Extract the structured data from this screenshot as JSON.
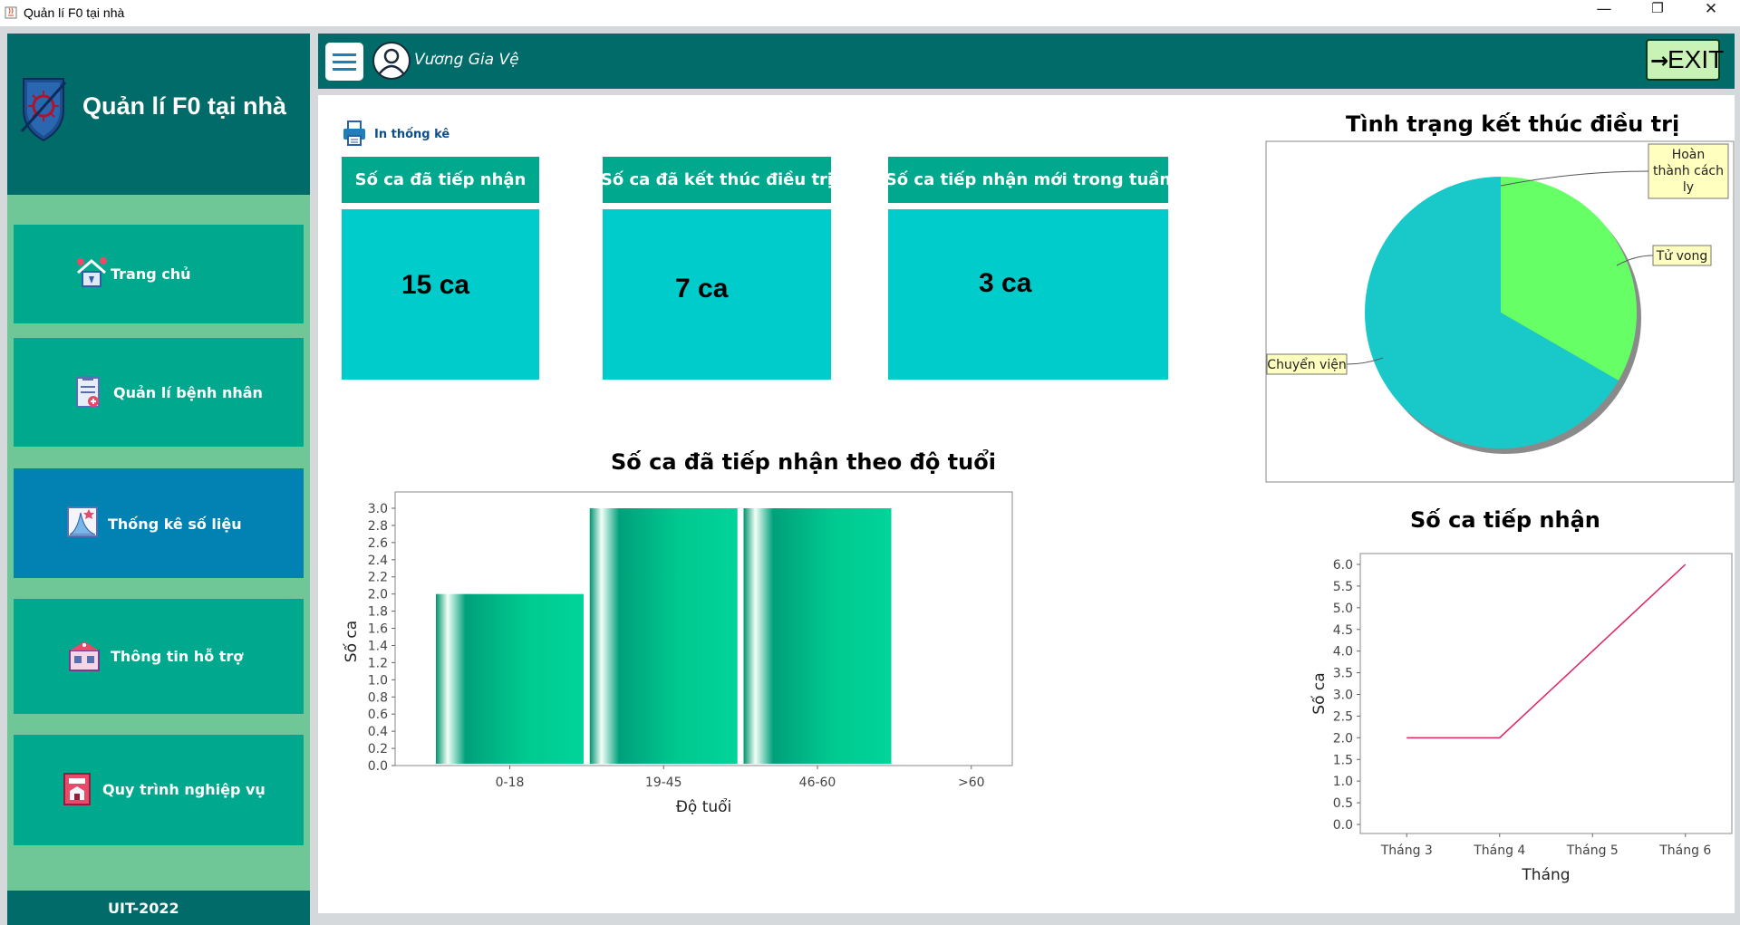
{
  "window": {
    "title": "Quản lí F0 tại nhà",
    "controls": {
      "minimize": "—",
      "restore": "❐",
      "close": "✕"
    }
  },
  "sidebar": {
    "title": "Quản lí F0 tại nhà",
    "items": [
      {
        "label": "Trang chủ",
        "icon": "home-icon",
        "active": false
      },
      {
        "label": "Quản lí bệnh nhân",
        "icon": "patient-record-icon",
        "active": false
      },
      {
        "label": "Thống kê số liệu",
        "icon": "chart-icon",
        "active": true
      },
      {
        "label": "Thông tin hỗ trợ",
        "icon": "support-icon",
        "active": false
      },
      {
        "label": "Quy trình nghiệp vụ",
        "icon": "procedure-book-icon",
        "active": false
      }
    ],
    "footer": "UIT-2022"
  },
  "header": {
    "user_name": "Vương Gia Vệ",
    "exit_label": "EXIT",
    "exit_arrow": "→"
  },
  "print_label": "In thống kê",
  "cards": [
    {
      "title": "Số ca đã tiếp nhận",
      "value": "15 ca"
    },
    {
      "title": "Số ca đã kết thúc điều trị",
      "value": "7 ca"
    },
    {
      "title": "Số ca tiếp nhận mới trong tuần",
      "value": "3 ca"
    }
  ],
  "colors": {
    "teal_dark": "#006b69",
    "teal": "#00a88d",
    "cyan": "#00cccc",
    "active_blue": "#0281b3",
    "sidebar_green": "#6fc797",
    "pie_cyan": "#19c9c9",
    "pie_green": "#66ff66",
    "line_red": "#e0245e"
  },
  "chart_data": [
    {
      "type": "bar",
      "title": "Số ca đã tiếp nhận theo độ tuổi",
      "xlabel": "Độ tuổi",
      "ylabel": "Số ca",
      "categories": [
        "0-18",
        "19-45",
        "46-60",
        ">60"
      ],
      "values": [
        2,
        3,
        3,
        0
      ],
      "ylim": [
        0,
        3.0
      ],
      "yticks": [
        "0.0",
        "0.2",
        "0.4",
        "0.6",
        "0.8",
        "1.0",
        "1.2",
        "1.4",
        "1.6",
        "1.8",
        "2.0",
        "2.2",
        "2.4",
        "2.6",
        "2.8",
        "3.0"
      ],
      "grid": false
    },
    {
      "type": "pie",
      "title": "Tình trạng kết thúc điều trị",
      "slices": [
        {
          "label": "Hoàn thành cách ly",
          "value": 0,
          "color": "#66ff66"
        },
        {
          "label": "Tử vong",
          "value": 1,
          "color": "#66ff66"
        },
        {
          "label": "Chuyển viện",
          "value": 2,
          "color": "#19c9c9"
        }
      ]
    },
    {
      "type": "line",
      "title": "Số ca tiếp nhận",
      "xlabel": "Tháng",
      "ylabel": "Số ca",
      "categories": [
        "Tháng 3",
        "Tháng 4",
        "Tháng 5",
        "Tháng 6"
      ],
      "values": [
        2,
        2,
        4,
        6
      ],
      "ylim": [
        0,
        6.0
      ],
      "yticks": [
        "0.0",
        "0.5",
        "1.0",
        "1.5",
        "2.0",
        "2.5",
        "3.0",
        "3.5",
        "4.0",
        "4.5",
        "5.0",
        "5.5",
        "6.0"
      ],
      "grid": false
    }
  ]
}
